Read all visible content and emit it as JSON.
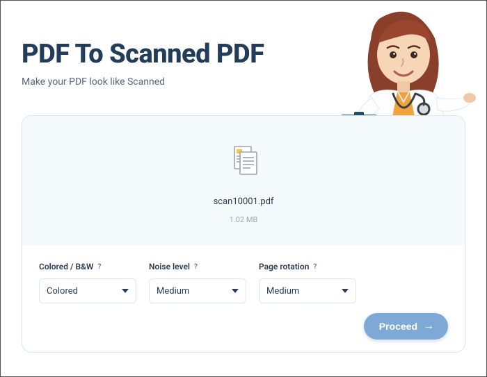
{
  "header": {
    "title": "PDF To Scanned PDF",
    "subtitle": "Make your PDF look like Scanned"
  },
  "file": {
    "name": "scan10001.pdf",
    "size": "1.02 MB"
  },
  "options": {
    "color": {
      "label": "Colored / B&W",
      "value": "Colored"
    },
    "noise": {
      "label": "Noise level",
      "value": "Medium"
    },
    "rotation": {
      "label": "Page rotation",
      "value": "Medium"
    }
  },
  "actions": {
    "proceed": "Proceed"
  }
}
